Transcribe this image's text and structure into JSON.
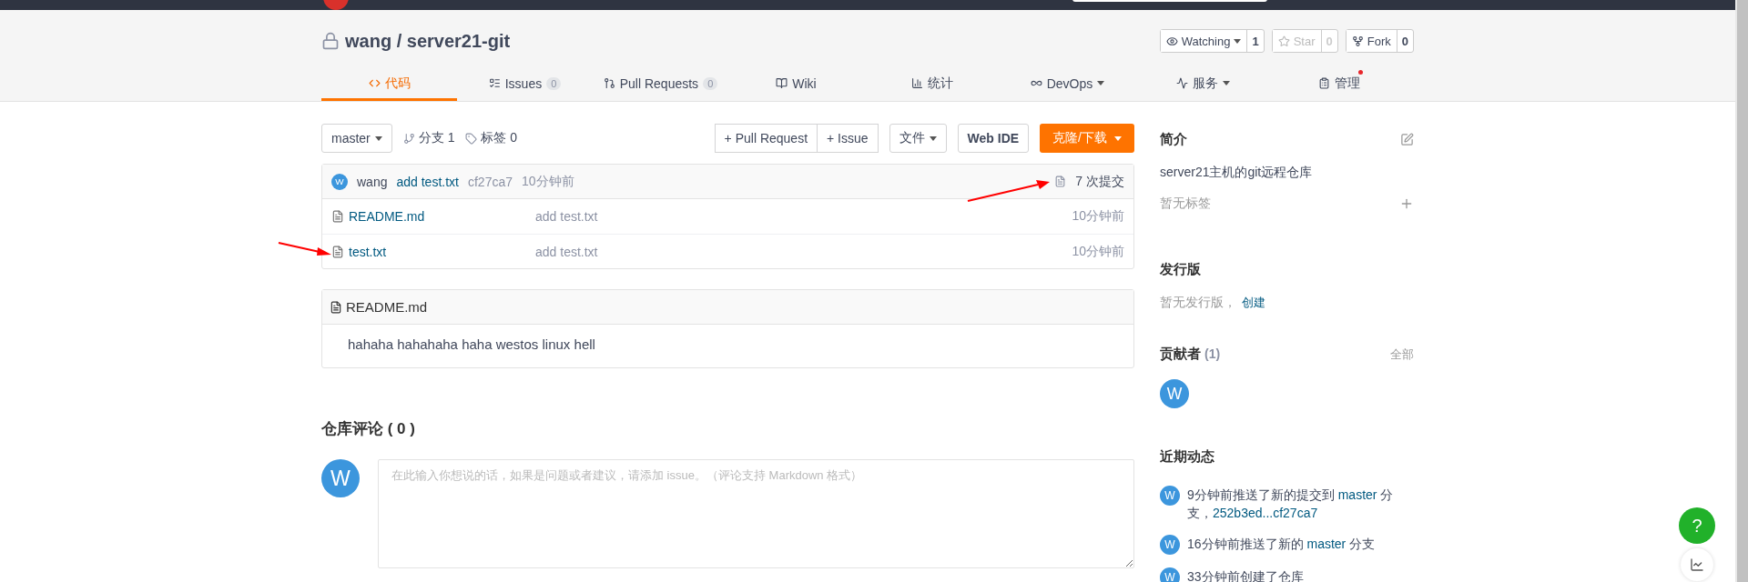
{
  "repo": {
    "title": "wang / server21-git",
    "private": true
  },
  "social": [
    {
      "kind": "watch",
      "label": "Watching",
      "count": "1",
      "disabled": false,
      "dropdown": true
    },
    {
      "kind": "star",
      "label": "Star",
      "count": "0",
      "disabled": true,
      "dropdown": false
    },
    {
      "kind": "fork",
      "label": "Fork",
      "count": "0",
      "disabled": false,
      "dropdown": false
    }
  ],
  "tabs": [
    {
      "kind": "code",
      "label": "代码",
      "selected": true
    },
    {
      "kind": "issues",
      "label": "Issues",
      "count": "0",
      "selected": false
    },
    {
      "kind": "pulls",
      "label": "Pull Requests",
      "count": "0",
      "selected": false
    },
    {
      "kind": "wiki",
      "label": "Wiki",
      "selected": false
    },
    {
      "kind": "stats",
      "label": "统计",
      "selected": false
    },
    {
      "kind": "devops",
      "label": "DevOps",
      "dropdown": true,
      "selected": false
    },
    {
      "kind": "services",
      "label": "服务",
      "dropdown": true,
      "selected": false
    },
    {
      "kind": "manage",
      "label": "管理",
      "dot": true,
      "selected": false
    }
  ],
  "toolbar": {
    "branch": "master",
    "branches": "分支 1",
    "tags": "标签 0",
    "actions": [
      "+ Pull Request",
      "+ Issue"
    ],
    "file_menu": "文件",
    "web_ide": "Web IDE",
    "clone": "克隆/下载"
  },
  "last_commit": {
    "avatar": "W",
    "author": "wang",
    "message": "add test.txt",
    "sha": "cf27ca7",
    "time": "10分钟前",
    "commits": "7 次提交"
  },
  "files": [
    {
      "name": "README.md",
      "message": "add test.txt",
      "time": "10分钟前"
    },
    {
      "name": "test.txt",
      "message": "add test.txt",
      "time": "10分钟前"
    }
  ],
  "readme": {
    "title": "README.md",
    "content": "hahaha hahahaha haha westos linux hell"
  },
  "comments": {
    "title": "仓库评论 ( 0 )",
    "avatar": "W",
    "placeholder": "在此输入你想说的话，如果是问题或者建议，请添加 issue。（评论支持 Markdown 格式）"
  },
  "sidebar": {
    "intro": {
      "title": "简介",
      "description": "server21主机的git远程仓库",
      "tags_empty": "暂无标签"
    },
    "releases": {
      "title": "发行版",
      "empty": "暂无发行版，",
      "create_link": "创建"
    },
    "contributors": {
      "title": "贡献者",
      "count": "(1)",
      "all_link": "全部",
      "avatars": [
        "W"
      ]
    },
    "activity": {
      "title": "近期动态",
      "items": [
        {
          "avatar": "W",
          "parts": [
            {
              "kind": "text",
              "text": "9分钟前推送了新的提交到 "
            },
            {
              "kind": "link",
              "text": "master"
            },
            {
              "kind": "text",
              "text": " 分支，"
            },
            {
              "kind": "link",
              "text": "252b3ed...cf27ca7"
            }
          ]
        },
        {
          "avatar": "W",
          "parts": [
            {
              "kind": "text",
              "text": "16分钟前推送了新的 "
            },
            {
              "kind": "link",
              "text": "master"
            },
            {
              "kind": "text",
              "text": " 分支"
            }
          ]
        },
        {
          "avatar": "W",
          "parts": [
            {
              "kind": "text",
              "text": "33分钟前创建了仓库"
            }
          ]
        }
      ]
    }
  },
  "help_button": "?"
}
